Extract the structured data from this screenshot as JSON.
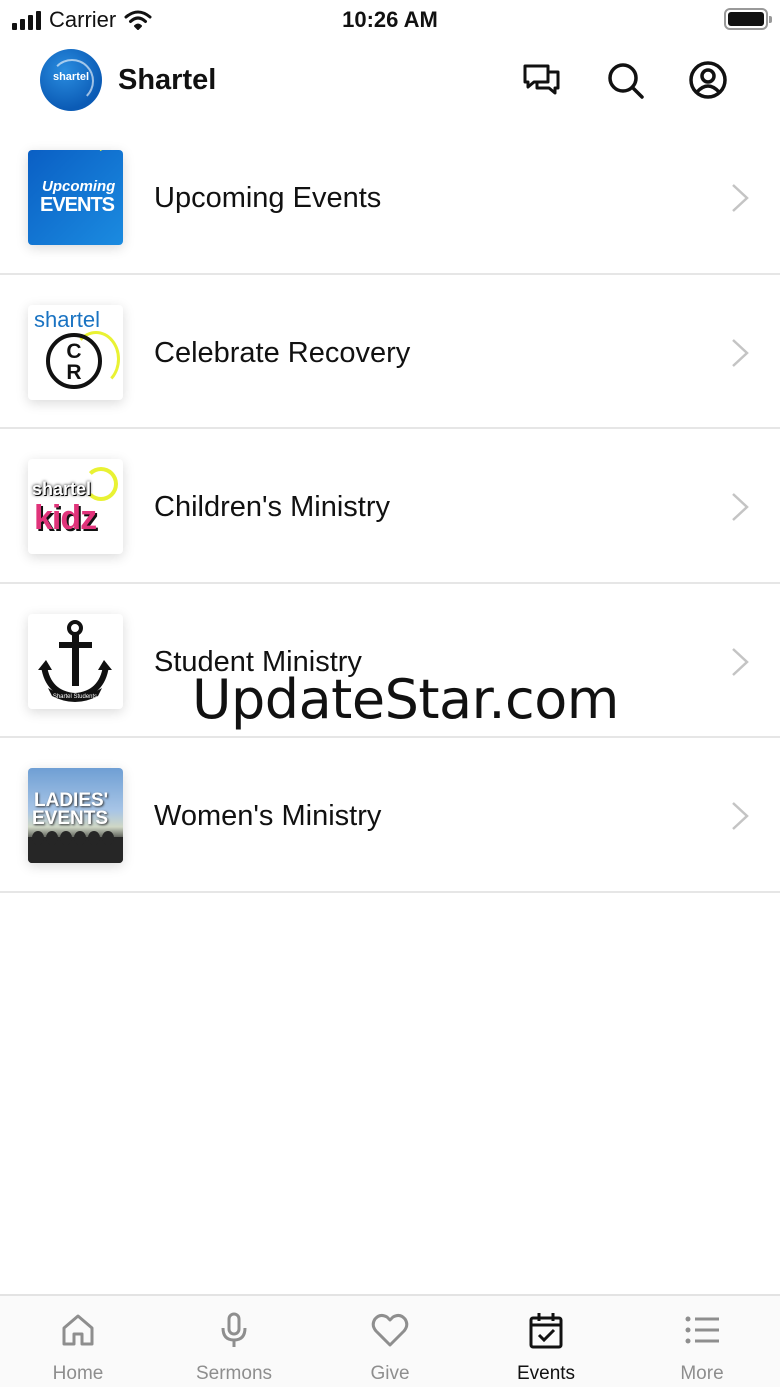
{
  "status_bar": {
    "carrier": "Carrier",
    "time": "10:26 AM"
  },
  "header": {
    "title": "Shartel",
    "logo_text": "shartel"
  },
  "events": [
    {
      "label": "Upcoming Events",
      "thumb_lines": [
        "Upcoming",
        "EVENTS"
      ]
    },
    {
      "label": "Celebrate Recovery",
      "thumb_lines": [
        "shartel",
        "C",
        "R"
      ]
    },
    {
      "label": "Children's Ministry",
      "thumb_lines": [
        "shartel",
        "kidz"
      ]
    },
    {
      "label": "Student Ministry",
      "thumb_lines": [
        "Shartel Students"
      ]
    },
    {
      "label": "Women's Ministry",
      "thumb_lines": [
        "LADIES'",
        "EVENTS"
      ]
    }
  ],
  "watermark": "UpdateStar.com",
  "tabs": [
    {
      "label": "Home",
      "icon": "home-icon",
      "active": false
    },
    {
      "label": "Sermons",
      "icon": "microphone-icon",
      "active": false
    },
    {
      "label": "Give",
      "icon": "heart-icon",
      "active": false
    },
    {
      "label": "Events",
      "icon": "calendar-check-icon",
      "active": true
    },
    {
      "label": "More",
      "icon": "list-icon",
      "active": false
    }
  ],
  "colors": {
    "active_tab": "#111111",
    "inactive_tab": "#8e8e8e",
    "brand_blue": "#0b5bb5",
    "accent_yellow": "#e9f233"
  }
}
